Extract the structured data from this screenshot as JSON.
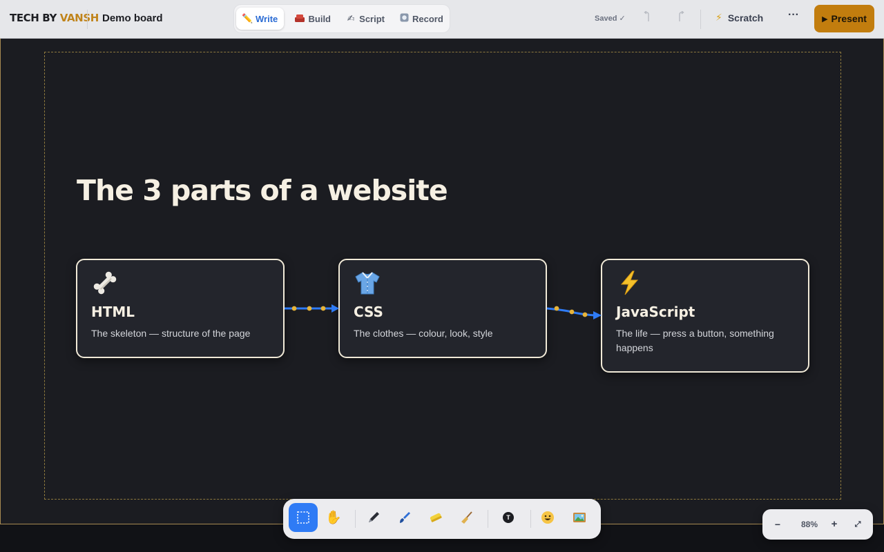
{
  "brand": {
    "part1": "TECH BY ",
    "part2": "VANSH"
  },
  "board": {
    "name": "Demo board"
  },
  "modes": [
    {
      "label": "Write",
      "icon": "pencil-icon",
      "active": true
    },
    {
      "label": "Build",
      "icon": "bricks-icon",
      "active": false
    },
    {
      "label": "Script",
      "icon": "writing-hand-icon",
      "active": false
    },
    {
      "label": "Record",
      "icon": "record-icon",
      "active": false
    }
  ],
  "header": {
    "saved": "Saved ✓",
    "scratch_label": "Scratch",
    "more_label": "···",
    "present_label": "Present",
    "present_icon": "▶"
  },
  "slide": {
    "title": "The 3 parts of a website",
    "cards": [
      {
        "emoji": "bone-icon",
        "title": "HTML",
        "desc": "The skeleton — structure of the page"
      },
      {
        "emoji": "shirt-icon",
        "title": "CSS",
        "desc": "The clothes — colour, look, style"
      },
      {
        "emoji": "lightning-icon",
        "title": "JavaScript",
        "desc": "The life — press a button, something happens"
      }
    ]
  },
  "toolbar": {
    "tools": [
      "select-tool",
      "hand-tool",
      "pen-tool",
      "brush-tool",
      "eraser-tool",
      "broom-tool",
      "text-tool",
      "emoji-tool",
      "image-tool"
    ],
    "text_tool_glyph": "T"
  },
  "zoom": {
    "minus": "−",
    "value": "88%",
    "plus": "+",
    "fit": "⤢"
  },
  "colors": {
    "accent": "#2f7bf5",
    "brand": "#c0841b",
    "present": "#c27d0e",
    "connector": "#2f7bf5",
    "connector_dots": "#e6b33a"
  }
}
